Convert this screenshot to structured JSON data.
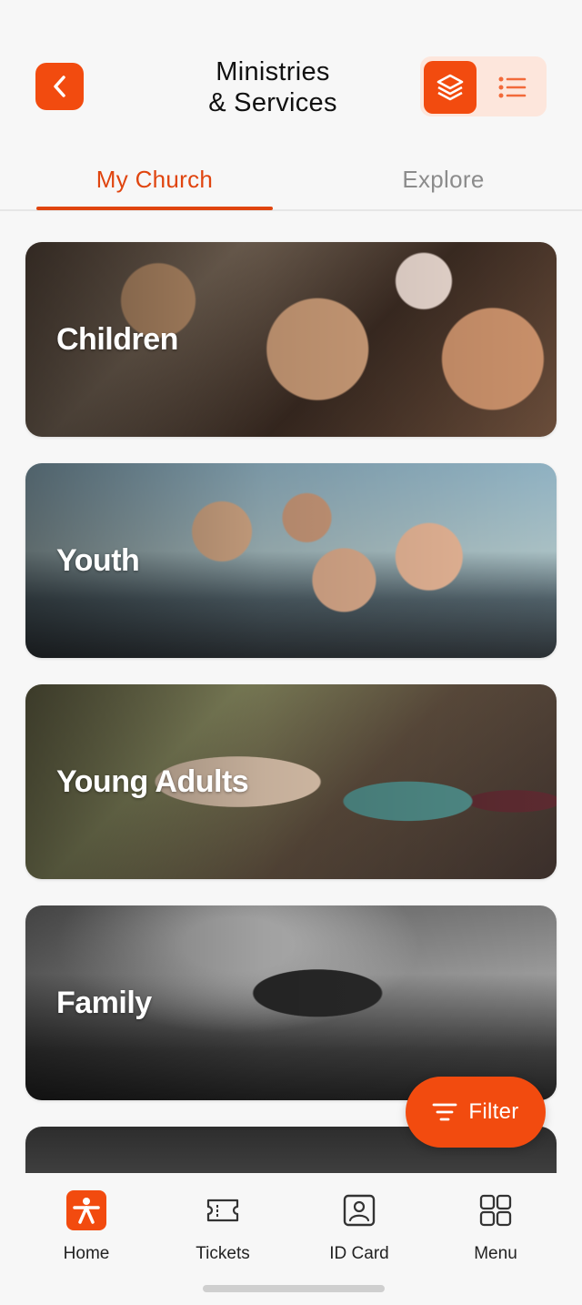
{
  "header": {
    "title_line1": "Ministries",
    "title_line2": "& Services",
    "back_icon": "chevron-left-icon",
    "view_toggle": {
      "active": "layers-icon",
      "inactive": "list-icon"
    }
  },
  "tabs": [
    {
      "label": "My Church",
      "active": true
    },
    {
      "label": "Explore",
      "active": false
    }
  ],
  "ministries": [
    {
      "label": "Children"
    },
    {
      "label": "Youth"
    },
    {
      "label": "Young Adults"
    },
    {
      "label": "Family"
    }
  ],
  "filter": {
    "label": "Filter",
    "icon": "filter-icon"
  },
  "bottom_nav": [
    {
      "label": "Home",
      "icon": "home-person-icon",
      "active": true
    },
    {
      "label": "Tickets",
      "icon": "ticket-icon",
      "active": false
    },
    {
      "label": "ID Card",
      "icon": "id-card-icon",
      "active": false
    },
    {
      "label": "Menu",
      "icon": "grid-icon",
      "active": false
    }
  ],
  "colors": {
    "accent": "#f24b0f",
    "accent_light": "#fde6dc",
    "tab_inactive": "#8c8c8c"
  }
}
